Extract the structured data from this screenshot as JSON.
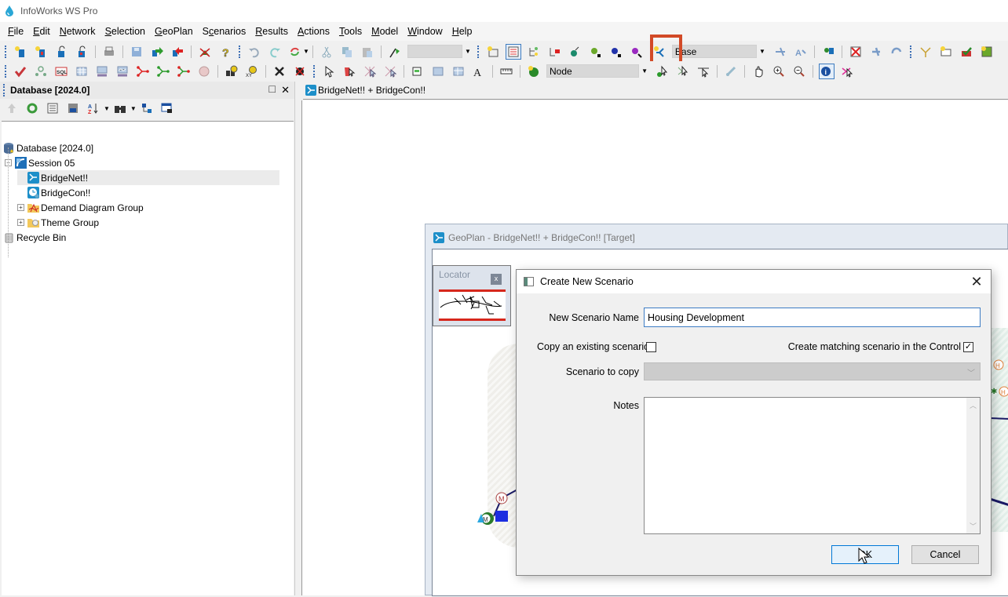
{
  "app": {
    "title": "InfoWorks WS Pro",
    "icon": "water-drop-icon"
  },
  "menu": [
    {
      "label": "File",
      "accel": "F"
    },
    {
      "label": "Edit",
      "accel": "E"
    },
    {
      "label": "Network",
      "accel": "N"
    },
    {
      "label": "Selection",
      "accel": "S"
    },
    {
      "label": "GeoPlan",
      "accel": "G"
    },
    {
      "label": "Scenarios",
      "accel": "c"
    },
    {
      "label": "Results",
      "accel": "R"
    },
    {
      "label": "Actions",
      "accel": "A"
    },
    {
      "label": "Tools",
      "accel": "T"
    },
    {
      "label": "Model",
      "accel": "M"
    },
    {
      "label": "Window",
      "accel": "W"
    },
    {
      "label": "Help",
      "accel": "H"
    }
  ],
  "toolbar": {
    "blank_combo_value": "",
    "scenario_combo_value": "Base",
    "object_type_combo_value": "Node",
    "highlighted_button": "create-scenario-icon"
  },
  "database_panel": {
    "title": "Database [2024.0]",
    "tree": [
      {
        "label": "Database [2024.0]",
        "icon": "database-icon",
        "level": 0
      },
      {
        "label": "Session 05",
        "icon": "session-icon",
        "level": 1,
        "expanded": true
      },
      {
        "label": "BridgeNet!!",
        "icon": "network-icon",
        "level": 2,
        "selected": true
      },
      {
        "label": "BridgeCon!!",
        "icon": "control-icon",
        "level": 2
      },
      {
        "label": "Demand Diagram Group",
        "icon": "demand-folder-icon",
        "level": 2,
        "expandable": true
      },
      {
        "label": "Theme Group",
        "icon": "theme-folder-icon",
        "level": 2,
        "expandable": true
      },
      {
        "label": "Recycle Bin",
        "icon": "recycle-bin-icon",
        "level": 0
      }
    ]
  },
  "document_tab": {
    "label": "BridgeNet!! + BridgeCon!!"
  },
  "geoplan": {
    "title": "GeoPlan - BridgeNet!! + BridgeCon!! [Target]",
    "locator": {
      "title": "Locator",
      "close": "x"
    },
    "map_markers": [
      "M",
      "M",
      "H",
      "H"
    ]
  },
  "dialog": {
    "title": "Create New Scenario",
    "close": "✕",
    "name_label": "New Scenario Name",
    "name_value": "Housing Development",
    "copy_label": "Copy an existing scenario",
    "copy_checked": false,
    "matching_label": "Create matching scenario in the Control",
    "matching_checked": true,
    "scenario_to_copy_label": "Scenario to copy",
    "scenario_to_copy_value": "",
    "notes_label": "Notes",
    "notes_value": "",
    "ok_label": "OK",
    "cancel_label": "Cancel"
  }
}
